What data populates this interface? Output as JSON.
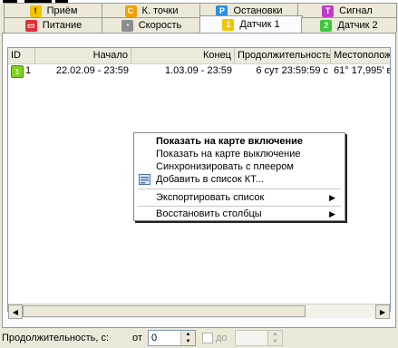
{
  "tabs": {
    "row1": [
      {
        "label": "Приём",
        "badge": "!",
        "badge_color": "#f2c400"
      },
      {
        "label": "К. точки",
        "badge": "C",
        "badge_color": "#f2a000"
      },
      {
        "label": "Остановки",
        "badge": "P",
        "badge_color": "#2d8fe0"
      },
      {
        "label": "Сигнал",
        "badge": "T",
        "badge_color": "#c03cc8"
      }
    ],
    "row2": [
      {
        "label": "Питание",
        "badge": "▭",
        "badge_color": "#e0303a"
      },
      {
        "label": "Скорость",
        "badge": "◔",
        "badge_color": "#8c8c8c"
      },
      {
        "label": "Датчик 1",
        "badge": "1",
        "badge_color": "#f2c400"
      },
      {
        "label": "Датчик 2",
        "badge": "2",
        "badge_color": "#3cc83c"
      }
    ]
  },
  "table": {
    "columns": [
      "ID",
      "Начало",
      "Конец",
      "Продолжительность",
      "Местополож"
    ],
    "rows": [
      {
        "id": "1",
        "start": "22.02.09 - 23:59",
        "end": "1.03.09 - 23:59",
        "duration": "6 сут 23:59:59 с",
        "location": "61° 17,995' в"
      }
    ]
  },
  "context_menu": {
    "items": [
      "Показать на карте включение",
      "Показать на карте выключение",
      "Синхронизировать с плеером",
      "Добавить в список КТ...",
      "Экспортировать список",
      "Восстановить столбцы"
    ]
  },
  "bottom": {
    "duration_label": "Продолжительность, с:",
    "from_label": "от",
    "from_value": "0",
    "to_label": "до",
    "to_value": ""
  }
}
